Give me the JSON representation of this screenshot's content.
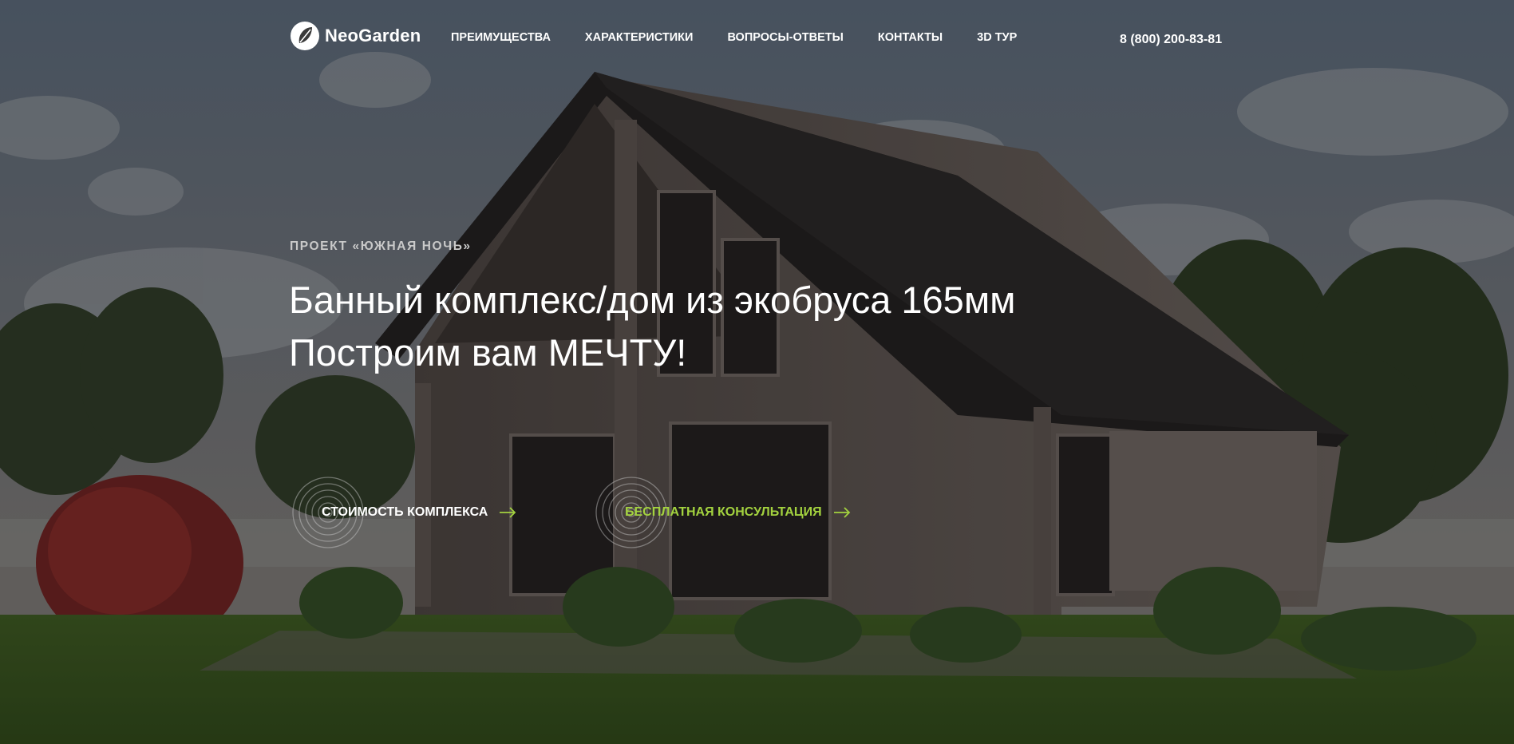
{
  "brand": {
    "name": "NeoGarden",
    "accent_color": "#a3d23f"
  },
  "nav": {
    "items": [
      {
        "label": "ПРЕИМУЩЕСТВА"
      },
      {
        "label": "ХАРАКТЕРИСТИКИ"
      },
      {
        "label": "ВОПРОСЫ-ОТВЕТЫ"
      },
      {
        "label": "КОНТАКТЫ"
      },
      {
        "label": "3D ТУР"
      }
    ],
    "phone": "8 (800) 200-83-81"
  },
  "hero": {
    "eyebrow": "ПРОЕКТ «ЮЖНАЯ НОЧЬ»",
    "headline_line1": "Банный комплекс/дом из экобруса 165мм",
    "headline_line2": "Построим вам МЕЧТУ!",
    "cta_primary": {
      "label": "СТОИМОСТЬ КОМПЛЕКСА",
      "icon": "arrow-right-icon"
    },
    "cta_secondary": {
      "label": "БЕСПЛАТНАЯ КОНСУЛЬТАЦИЯ",
      "icon": "arrow-right-icon"
    }
  }
}
